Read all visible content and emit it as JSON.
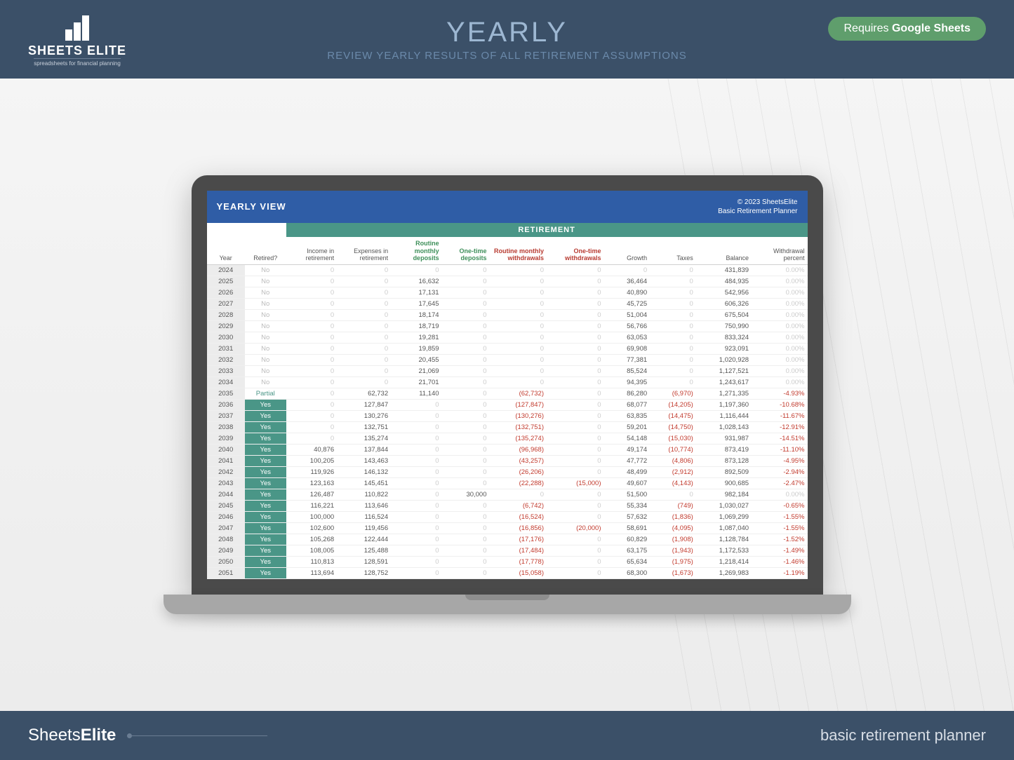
{
  "header": {
    "logo_main": "SHEETS ELITE",
    "logo_sub": "spreadsheets for financial planning",
    "title": "YEARLY",
    "subtitle": "REVIEW YEARLY RESULTS OF ALL RETIREMENT ASSUMPTIONS",
    "badge_prefix": "Requires ",
    "badge_strong": "Google Sheets"
  },
  "sheet": {
    "title": "YEARLY VIEW",
    "copyright": "© 2023 SheetsElite",
    "product": "Basic Retirement Planner",
    "group": "RETIREMENT",
    "columns": [
      "Year",
      "Retired?",
      "Income in retirement",
      "Expenses in retirement",
      "Routine monthly deposits",
      "One-time deposits",
      "Routine monthly withdrawals",
      "One-time withdrawals",
      "Growth",
      "Taxes",
      "Balance",
      "Withdrawal percent"
    ]
  },
  "rows": [
    {
      "year": "2024",
      "retired": "No",
      "income": "0",
      "expenses": "0",
      "rmd": "0",
      "otd": "0",
      "rmw": "0",
      "otw": "0",
      "growth": "0",
      "taxes": "0",
      "balance": "431,839",
      "wp": "0.00%"
    },
    {
      "year": "2025",
      "retired": "No",
      "income": "0",
      "expenses": "0",
      "rmd": "16,632",
      "otd": "0",
      "rmw": "0",
      "otw": "0",
      "growth": "36,464",
      "taxes": "0",
      "balance": "484,935",
      "wp": "0.00%"
    },
    {
      "year": "2026",
      "retired": "No",
      "income": "0",
      "expenses": "0",
      "rmd": "17,131",
      "otd": "0",
      "rmw": "0",
      "otw": "0",
      "growth": "40,890",
      "taxes": "0",
      "balance": "542,956",
      "wp": "0.00%"
    },
    {
      "year": "2027",
      "retired": "No",
      "income": "0",
      "expenses": "0",
      "rmd": "17,645",
      "otd": "0",
      "rmw": "0",
      "otw": "0",
      "growth": "45,725",
      "taxes": "0",
      "balance": "606,326",
      "wp": "0.00%"
    },
    {
      "year": "2028",
      "retired": "No",
      "income": "0",
      "expenses": "0",
      "rmd": "18,174",
      "otd": "0",
      "rmw": "0",
      "otw": "0",
      "growth": "51,004",
      "taxes": "0",
      "balance": "675,504",
      "wp": "0.00%"
    },
    {
      "year": "2029",
      "retired": "No",
      "income": "0",
      "expenses": "0",
      "rmd": "18,719",
      "otd": "0",
      "rmw": "0",
      "otw": "0",
      "growth": "56,766",
      "taxes": "0",
      "balance": "750,990",
      "wp": "0.00%"
    },
    {
      "year": "2030",
      "retired": "No",
      "income": "0",
      "expenses": "0",
      "rmd": "19,281",
      "otd": "0",
      "rmw": "0",
      "otw": "0",
      "growth": "63,053",
      "taxes": "0",
      "balance": "833,324",
      "wp": "0.00%"
    },
    {
      "year": "2031",
      "retired": "No",
      "income": "0",
      "expenses": "0",
      "rmd": "19,859",
      "otd": "0",
      "rmw": "0",
      "otw": "0",
      "growth": "69,908",
      "taxes": "0",
      "balance": "923,091",
      "wp": "0.00%"
    },
    {
      "year": "2032",
      "retired": "No",
      "income": "0",
      "expenses": "0",
      "rmd": "20,455",
      "otd": "0",
      "rmw": "0",
      "otw": "0",
      "growth": "77,381",
      "taxes": "0",
      "balance": "1,020,928",
      "wp": "0.00%"
    },
    {
      "year": "2033",
      "retired": "No",
      "income": "0",
      "expenses": "0",
      "rmd": "21,069",
      "otd": "0",
      "rmw": "0",
      "otw": "0",
      "growth": "85,524",
      "taxes": "0",
      "balance": "1,127,521",
      "wp": "0.00%"
    },
    {
      "year": "2034",
      "retired": "No",
      "income": "0",
      "expenses": "0",
      "rmd": "21,701",
      "otd": "0",
      "rmw": "0",
      "otw": "0",
      "growth": "94,395",
      "taxes": "0",
      "balance": "1,243,617",
      "wp": "0.00%"
    },
    {
      "year": "2035",
      "retired": "Partial",
      "income": "0",
      "expenses": "62,732",
      "rmd": "11,140",
      "otd": "0",
      "rmw": "(62,732)",
      "otw": "0",
      "growth": "86,280",
      "taxes": "(6,970)",
      "balance": "1,271,335",
      "wp": "-4.93%"
    },
    {
      "year": "2036",
      "retired": "Yes",
      "income": "0",
      "expenses": "127,847",
      "rmd": "0",
      "otd": "0",
      "rmw": "(127,847)",
      "otw": "0",
      "growth": "68,077",
      "taxes": "(14,205)",
      "balance": "1,197,360",
      "wp": "-10.68%"
    },
    {
      "year": "2037",
      "retired": "Yes",
      "income": "0",
      "expenses": "130,276",
      "rmd": "0",
      "otd": "0",
      "rmw": "(130,276)",
      "otw": "0",
      "growth": "63,835",
      "taxes": "(14,475)",
      "balance": "1,116,444",
      "wp": "-11.67%"
    },
    {
      "year": "2038",
      "retired": "Yes",
      "income": "0",
      "expenses": "132,751",
      "rmd": "0",
      "otd": "0",
      "rmw": "(132,751)",
      "otw": "0",
      "growth": "59,201",
      "taxes": "(14,750)",
      "balance": "1,028,143",
      "wp": "-12.91%"
    },
    {
      "year": "2039",
      "retired": "Yes",
      "income": "0",
      "expenses": "135,274",
      "rmd": "0",
      "otd": "0",
      "rmw": "(135,274)",
      "otw": "0",
      "growth": "54,148",
      "taxes": "(15,030)",
      "balance": "931,987",
      "wp": "-14.51%"
    },
    {
      "year": "2040",
      "retired": "Yes",
      "income": "40,876",
      "expenses": "137,844",
      "rmd": "0",
      "otd": "0",
      "rmw": "(96,968)",
      "otw": "0",
      "growth": "49,174",
      "taxes": "(10,774)",
      "balance": "873,419",
      "wp": "-11.10%"
    },
    {
      "year": "2041",
      "retired": "Yes",
      "income": "100,205",
      "expenses": "143,463",
      "rmd": "0",
      "otd": "0",
      "rmw": "(43,257)",
      "otw": "0",
      "growth": "47,772",
      "taxes": "(4,806)",
      "balance": "873,128",
      "wp": "-4.95%"
    },
    {
      "year": "2042",
      "retired": "Yes",
      "income": "119,926",
      "expenses": "146,132",
      "rmd": "0",
      "otd": "0",
      "rmw": "(26,206)",
      "otw": "0",
      "growth": "48,499",
      "taxes": "(2,912)",
      "balance": "892,509",
      "wp": "-2.94%"
    },
    {
      "year": "2043",
      "retired": "Yes",
      "income": "123,163",
      "expenses": "145,451",
      "rmd": "0",
      "otd": "0",
      "rmw": "(22,288)",
      "otw": "(15,000)",
      "growth": "49,607",
      "taxes": "(4,143)",
      "balance": "900,685",
      "wp": "-2.47%"
    },
    {
      "year": "2044",
      "retired": "Yes",
      "income": "126,487",
      "expenses": "110,822",
      "rmd": "0",
      "otd": "30,000",
      "rmw": "0",
      "otw": "0",
      "growth": "51,500",
      "taxes": "0",
      "balance": "982,184",
      "wp": "0.00%"
    },
    {
      "year": "2045",
      "retired": "Yes",
      "income": "116,221",
      "expenses": "113,646",
      "rmd": "0",
      "otd": "0",
      "rmw": "(6,742)",
      "otw": "0",
      "growth": "55,334",
      "taxes": "(749)",
      "balance": "1,030,027",
      "wp": "-0.65%"
    },
    {
      "year": "2046",
      "retired": "Yes",
      "income": "100,000",
      "expenses": "116,524",
      "rmd": "0",
      "otd": "0",
      "rmw": "(16,524)",
      "otw": "0",
      "growth": "57,632",
      "taxes": "(1,836)",
      "balance": "1,069,299",
      "wp": "-1.55%"
    },
    {
      "year": "2047",
      "retired": "Yes",
      "income": "102,600",
      "expenses": "119,456",
      "rmd": "0",
      "otd": "0",
      "rmw": "(16,856)",
      "otw": "(20,000)",
      "growth": "58,691",
      "taxes": "(4,095)",
      "balance": "1,087,040",
      "wp": "-1.55%"
    },
    {
      "year": "2048",
      "retired": "Yes",
      "income": "105,268",
      "expenses": "122,444",
      "rmd": "0",
      "otd": "0",
      "rmw": "(17,176)",
      "otw": "0",
      "growth": "60,829",
      "taxes": "(1,908)",
      "balance": "1,128,784",
      "wp": "-1.52%"
    },
    {
      "year": "2049",
      "retired": "Yes",
      "income": "108,005",
      "expenses": "125,488",
      "rmd": "0",
      "otd": "0",
      "rmw": "(17,484)",
      "otw": "0",
      "growth": "63,175",
      "taxes": "(1,943)",
      "balance": "1,172,533",
      "wp": "-1.49%"
    },
    {
      "year": "2050",
      "retired": "Yes",
      "income": "110,813",
      "expenses": "128,591",
      "rmd": "0",
      "otd": "0",
      "rmw": "(17,778)",
      "otw": "0",
      "growth": "65,634",
      "taxes": "(1,975)",
      "balance": "1,218,414",
      "wp": "-1.46%"
    },
    {
      "year": "2051",
      "retired": "Yes",
      "income": "113,694",
      "expenses": "128,752",
      "rmd": "0",
      "otd": "0",
      "rmw": "(15,058)",
      "otw": "0",
      "growth": "68,300",
      "taxes": "(1,673)",
      "balance": "1,269,983",
      "wp": "-1.19%"
    }
  ],
  "footer": {
    "brand_thin": "Sheets",
    "brand_bold": "Elite",
    "right": "basic retirement planner"
  }
}
